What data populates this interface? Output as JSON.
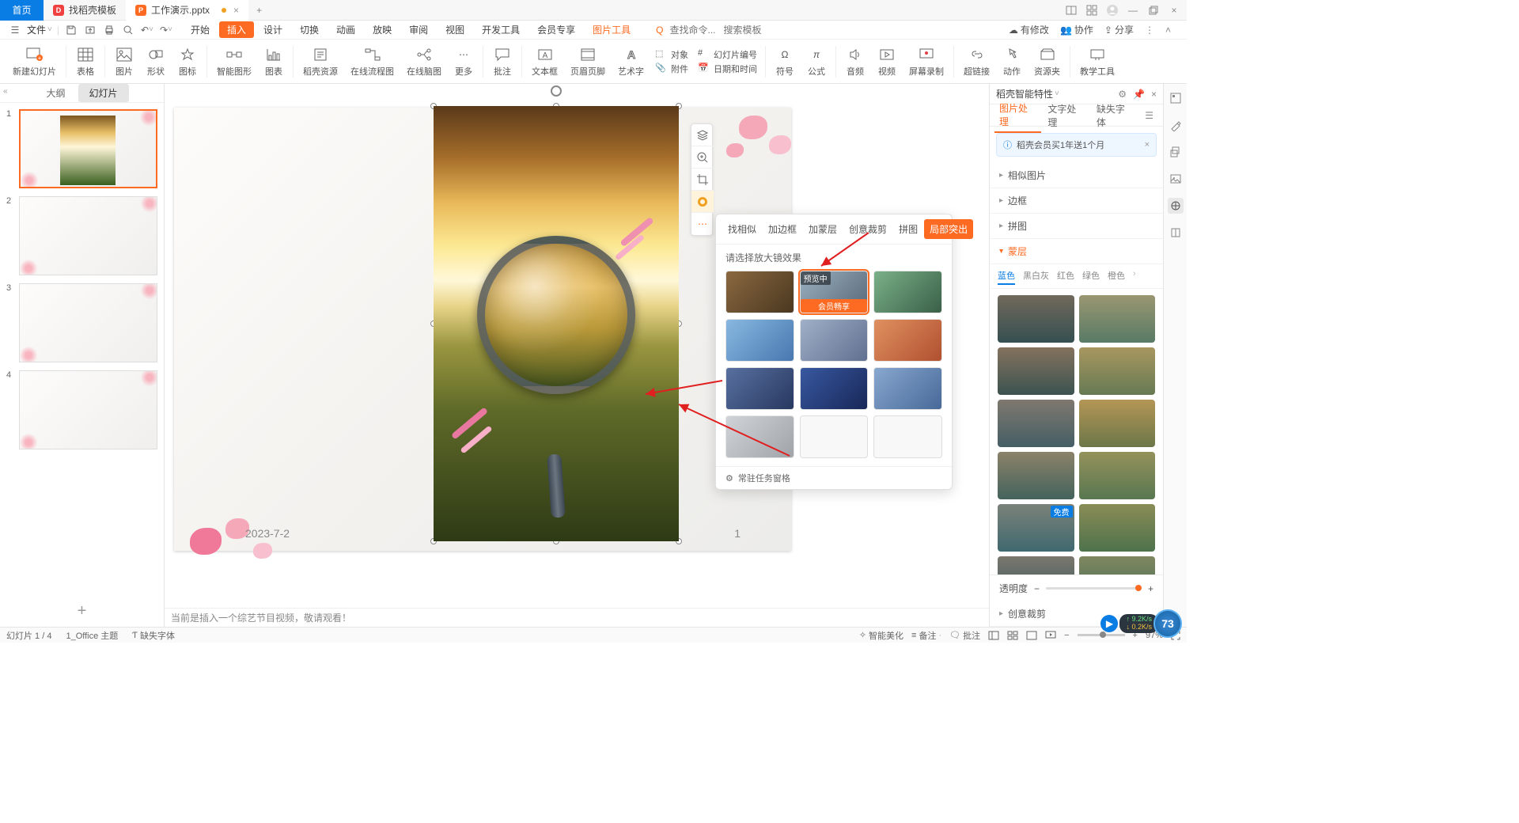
{
  "title_bar": {
    "home": "首页",
    "tab1": "找稻壳模板",
    "tab2": "工作演示.pptx",
    "add": "+"
  },
  "menu": {
    "file": "文件",
    "tabs": [
      "开始",
      "插入",
      "设计",
      "切换",
      "动画",
      "放映",
      "审阅",
      "视图",
      "开发工具",
      "会员专享"
    ],
    "selected_index": 1,
    "context_tab": "图片工具",
    "search_hint": "查找命令...",
    "search_template": "搜索模板"
  },
  "menu_right": {
    "modified": "有修改",
    "coop": "协作",
    "share": "分享"
  },
  "ribbon": {
    "items": [
      "新建幻灯片",
      "表格",
      "图片",
      "形状",
      "图标",
      "智能图形",
      "图表",
      "稻壳资源",
      "在线流程图",
      "在线脑图",
      "更多",
      "批注",
      "文本框",
      "页眉页脚",
      "艺术字",
      "符号",
      "公式",
      "音频",
      "视频",
      "屏幕录制",
      "超链接",
      "动作",
      "资源夹",
      "教学工具"
    ],
    "sub": {
      "object": "对象",
      "slidenum": "幻灯片编号",
      "attach": "附件",
      "datetime": "日期和时间"
    }
  },
  "panel": {
    "outline": "大纲",
    "slides": "幻灯片"
  },
  "slide_date": "2023-7-2",
  "slide_page": "1",
  "float_popup": {
    "tabs": [
      "找相似",
      "加边框",
      "加蒙层",
      "创意裁剪",
      "拼图",
      "局部突出"
    ],
    "active_index": 5,
    "hint": "请选择放大镜效果",
    "preview": "预览中",
    "vip": "会员畅享",
    "footer": "常驻任务窗格"
  },
  "right_panel": {
    "title": "稻壳智能特性",
    "tabs": [
      "图片处理",
      "文字处理",
      "缺失字体"
    ],
    "notice": "稻壳会员买1年送1个月",
    "sections": [
      "相似图片",
      "边框",
      "拼图"
    ],
    "active_section": "蒙层",
    "color_tabs": [
      "蓝色",
      "黑白灰",
      "红色",
      "绿色",
      "橙色"
    ],
    "free_tag": "免费",
    "opacity": "透明度",
    "more": "创意裁剪"
  },
  "notes_hint": "当前是插入一个综艺节目视频，敬请观看！",
  "status": {
    "slide_count": "幻灯片 1 / 4",
    "theme": "1_Office 主题",
    "missing": "缺失字体",
    "beautify": "智能美化",
    "notes": "备注",
    "comments": "批注",
    "zoom": "97%"
  },
  "corner": {
    "up": "9.2K/s",
    "down": "0.2K/s",
    "num": "73"
  }
}
